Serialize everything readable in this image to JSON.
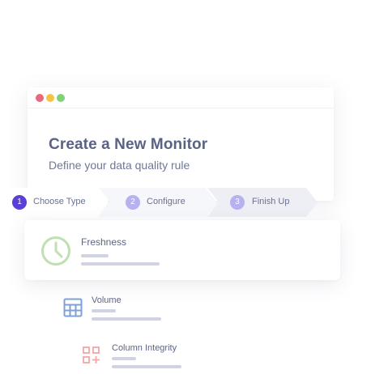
{
  "window": {
    "dots": {
      "red": "#e8697c",
      "yellow": "#f5c34a",
      "green": "#7ed27a"
    }
  },
  "header": {
    "title": "Create a New Monitor",
    "subtitle": "Define your data quality rule"
  },
  "stepper": {
    "steps": [
      {
        "number": "1",
        "label": "Choose Type",
        "active": true
      },
      {
        "number": "2",
        "label": "Configure",
        "active": false
      },
      {
        "number": "3",
        "label": "Finish Up",
        "active": false
      }
    ],
    "active_color": "#5b3fd6",
    "inactive_color": "#b6b1f0"
  },
  "monitor_types": [
    {
      "name": "Freshness",
      "icon": "clock-icon",
      "color": "#bfe0b0",
      "selected": true
    },
    {
      "name": "Volume",
      "icon": "table-icon",
      "color": "#7ea2d8",
      "selected": false
    },
    {
      "name": "Column Integrity",
      "icon": "grid-plus-icon",
      "color": "#f0a8a8",
      "selected": false
    }
  ]
}
